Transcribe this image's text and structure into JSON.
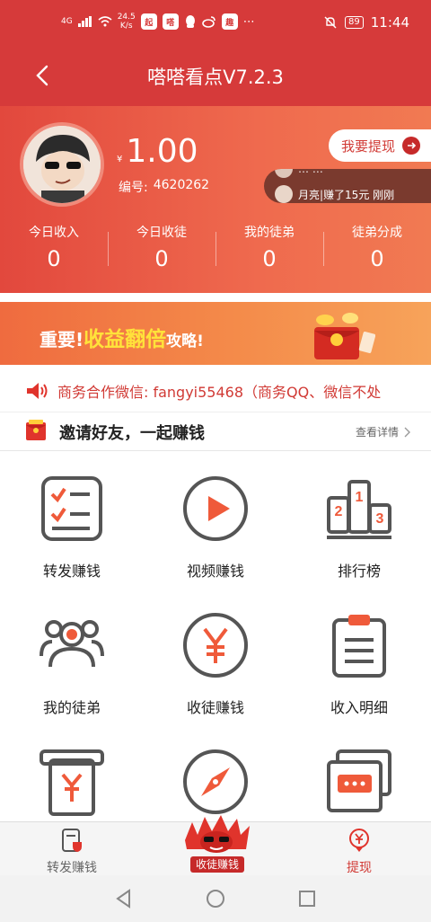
{
  "status_bar": {
    "network": "4G",
    "speed_value": "24.5",
    "speed_unit": "K/s",
    "app1": "起",
    "app2": "嗒",
    "battery": "89",
    "time": "11:44"
  },
  "header": {
    "title": "嗒嗒看点V7.2.3"
  },
  "profile": {
    "currency": "¥",
    "balance": "1.00",
    "id_label": "编号:",
    "id_value": "4620262",
    "withdraw_label": "我要提现",
    "ticker_prev": "…  …",
    "ticker_text": "月亮|赚了15元 刚刚"
  },
  "stats": [
    {
      "label": "今日收入",
      "value": "0"
    },
    {
      "label": "今日收徒",
      "value": "0"
    },
    {
      "label": "我的徒弟",
      "value": "0"
    },
    {
      "label": "徒弟分成",
      "value": "0"
    }
  ],
  "banner": {
    "prefix": "重要!",
    "highlight": "收益翻倍",
    "suffix": "攻略!"
  },
  "notice": {
    "text": "商务合作微信: fangyi55468（商务QQ、微信不处"
  },
  "invite": {
    "title": "邀请好友，一起赚钱",
    "more": "查看详情"
  },
  "grid": [
    {
      "label": "转发赚钱",
      "icon": "checklist-icon"
    },
    {
      "label": "视频赚钱",
      "icon": "play-icon"
    },
    {
      "label": "排行榜",
      "icon": "podium-icon"
    },
    {
      "label": "我的徒弟",
      "icon": "users-icon"
    },
    {
      "label": "收徒赚钱",
      "icon": "yen-circle-icon"
    },
    {
      "label": "收入明细",
      "icon": "clipboard-icon"
    },
    {
      "label": "",
      "icon": "atm-yen-icon"
    },
    {
      "label": "",
      "icon": "compass-icon"
    },
    {
      "label": "",
      "icon": "message-icon"
    }
  ],
  "tabbar": {
    "left": "转发赚钱",
    "center": "收徒赚钱",
    "right": "提现"
  },
  "colors": {
    "primary": "#d63a3a",
    "accent": "#f07a3a",
    "text": "#222222"
  }
}
